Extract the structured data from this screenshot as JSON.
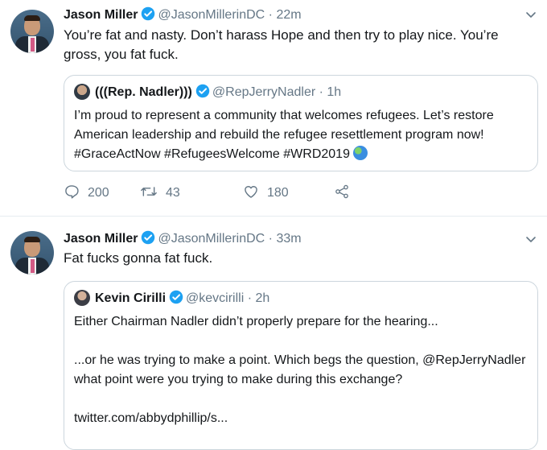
{
  "tweets": [
    {
      "author": "Jason Miller",
      "handle": "@JasonMillerinDC",
      "time": "22m",
      "text": "You’re fat and nasty. Don’t harass Hope and then try to play nice. You’re gross, you fat fuck.",
      "quote": {
        "author": "(((Rep. Nadler)))",
        "handle": "@RepJerryNadler",
        "time": "1h",
        "text": "I’m proud to represent a community that welcomes refugees. Let’s restore American leadership and rebuild the refugee resettlement program now! #GraceActNow #RefugeesWelcome #WRD2019"
      },
      "actions": {
        "replies": "200",
        "retweets": "43",
        "likes": "180"
      }
    },
    {
      "author": "Jason Miller",
      "handle": "@JasonMillerinDC",
      "time": "33m",
      "text": "Fat fucks gonna fat fuck.",
      "quote": {
        "author": "Kevin Cirilli",
        "handle": "@kevcirilli",
        "time": "2h",
        "line1": "Either Chairman Nadler didn’t properly prepare for the hearing...",
        "line2": "...or he was trying to make a point. Which begs the question, @RepJerryNadler what point were you trying to make during this exchange?",
        "line3": "twitter.com/abbydphillip/s..."
      }
    }
  ],
  "separator": "·",
  "colors": {
    "verified": "#1da1f2",
    "muted": "#657786",
    "text": "#14171a",
    "border": "#ccd6dd"
  },
  "icons": [
    "verified-badge-icon",
    "chevron-down-icon",
    "reply-icon",
    "retweet-icon",
    "like-icon",
    "share-icon",
    "globe-emoji-icon"
  ]
}
